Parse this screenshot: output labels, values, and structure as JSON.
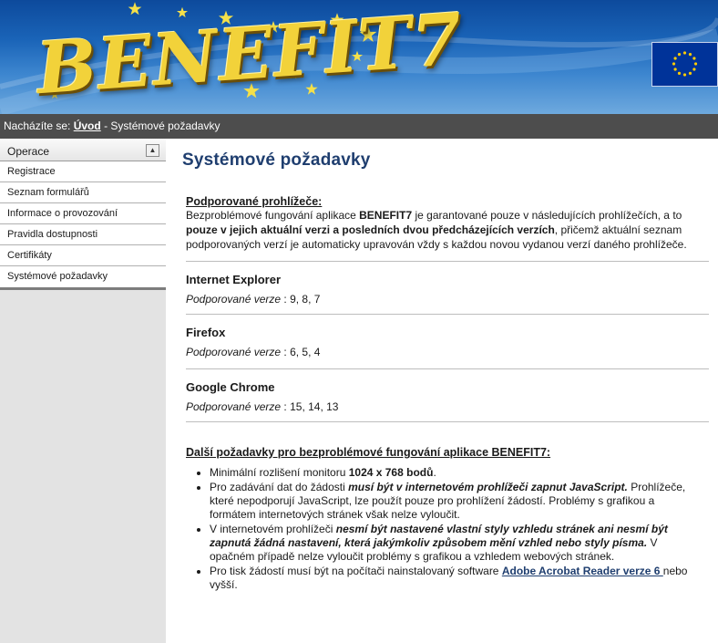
{
  "header": {
    "logo_text": "BENEFIT7"
  },
  "breadcrumb": {
    "prefix": "Nacházíte se:",
    "home": "Úvod",
    "separator": "-",
    "current": "Systémové požadavky"
  },
  "sidebar": {
    "header": "Operace",
    "collapse_icon": "chevron-up-icon",
    "items": [
      {
        "label": "Registrace"
      },
      {
        "label": "Seznam formulářů"
      },
      {
        "label": "Informace o provozování"
      },
      {
        "label": "Pravidla dostupnosti"
      },
      {
        "label": "Certifikáty"
      },
      {
        "label": "Systémové požadavky"
      }
    ]
  },
  "main": {
    "title": "Systémové požadavky",
    "supported": {
      "heading": "Podporované prohlížeče:",
      "intro_1": "Bezproblémové fungování aplikace ",
      "intro_app": "BENEFIT7",
      "intro_2": " je garantované pouze v následujících prohlížečích, a to ",
      "intro_bold": "pouze v jejich aktuální verzi a posledních dvou předcházejících verzích",
      "intro_3": ", přičemž aktuální seznam podporovaných verzí je automaticky upravován vždy s každou novou vydanou verzí daného prohlížeče."
    },
    "versions_label": "Podporované verze",
    "versions_sep": " : ",
    "browsers": [
      {
        "name": "Internet Explorer",
        "versions": "9, 8, 7"
      },
      {
        "name": "Firefox",
        "versions": "6, 5, 4"
      },
      {
        "name": "Google Chrome",
        "versions": "15, 14, 13"
      }
    ],
    "other": {
      "heading": "Další požadavky pro bezproblémové fungování aplikace BENEFIT7:",
      "item1_a": "Minimální rozlišení monitoru ",
      "item1_b": "1024 x 768 bodů",
      "item1_c": ".",
      "item2_a": "Pro zadávání dat do žádosti ",
      "item2_b": "musí být v internetovém prohlížeči zapnut JavaScript.",
      "item2_c": " Prohlížeče, které nepodporují JavaScript, lze použít pouze pro prohlížení žádostí. Problémy s grafikou a formátem internetových stránek však nelze vyloučit.",
      "item3_a": "V internetovém prohlížeči ",
      "item3_b": "nesmí být nastavené vlastní styly vzhledu stránek ani nesmí být zapnutá žádná nastavení, která jakýmkoliv způsobem mění vzhled nebo styly písma.",
      "item3_c": " V opačném případě nelze vyloučit problémy s grafikou a vzhledem webových stránek.",
      "item4_a": "Pro tisk žádostí musí být na počítači nainstalovaný software ",
      "item4_link": "Adobe Acrobat Reader verze 6 ",
      "item4_c": "nebo vyšší."
    }
  }
}
